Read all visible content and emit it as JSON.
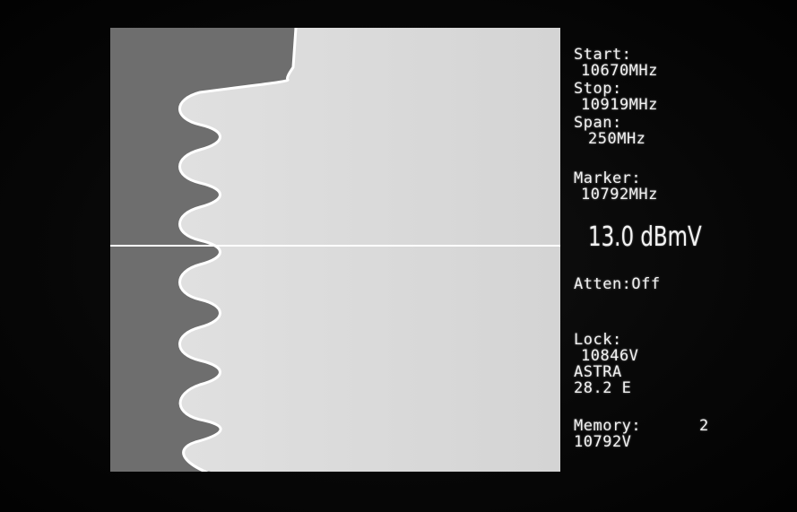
{
  "readout": {
    "start_label": "Start:",
    "start_value": "10670MHz",
    "stop_label": "Stop:",
    "stop_value": "10919MHz",
    "span_label": "Span:",
    "span_value": "250MHz",
    "marker_label": "Marker:",
    "marker_value": "10792MHz",
    "level": "13.0 dBmV",
    "atten": "Atten:Off",
    "lock_label": "Lock:",
    "lock_value": "10846V",
    "satellite_name": "ASTRA",
    "satellite_position": "28.2 E",
    "memory_label": "Memory:",
    "memory_number": "2",
    "memory_value": "10792V"
  },
  "colors": {
    "background": "#050505",
    "plot_dark": "#6e6e6e",
    "plot_light": "#d9d9d9",
    "trace": "#ffffff",
    "text": "#f2f2f2"
  }
}
